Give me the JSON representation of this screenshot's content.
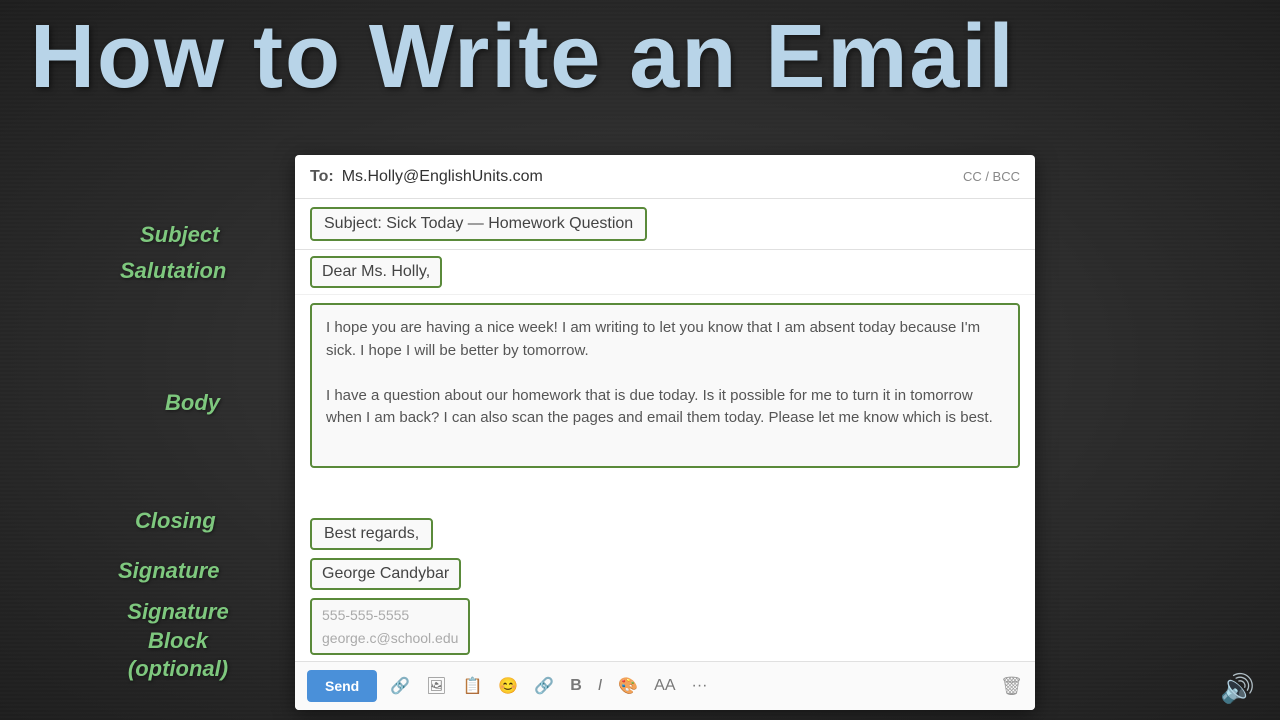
{
  "title": "How to Write an Email",
  "labels": {
    "subject": "Subject",
    "salutation": "Salutation",
    "body": "Body",
    "closing": "Closing",
    "signature": "Signature",
    "sigblock": "Signature\nBlock\n(optional)"
  },
  "email": {
    "to_label": "To:",
    "to_address": "Ms.Holly@EnglishUnits.com",
    "cc_bcc": "CC / BCC",
    "subject": "Subject:  Sick Today — Homework Question",
    "salutation": "Dear Ms. Holly,",
    "body_paragraph1": "I hope you are having a nice week! I am writing to let you know that I am absent today because I'm sick. I hope I will be better by tomorrow.",
    "body_paragraph2": "I have a question about our homework that is due today. Is it possible for me to turn it in tomorrow when I am back? I can also scan the pages and email them today. Please let me know which is best.",
    "closing": "Best regards,",
    "signature": "George Candybar",
    "sigblock_line1": "555-555-5555",
    "sigblock_line2": "george.c@school.edu",
    "send_button": "Send",
    "toolbar_icons": [
      "🔗",
      "📷",
      "📋",
      "😊",
      "🔗",
      "B",
      "I",
      "🎨",
      "AA",
      "..."
    ],
    "trash": "🗑"
  }
}
